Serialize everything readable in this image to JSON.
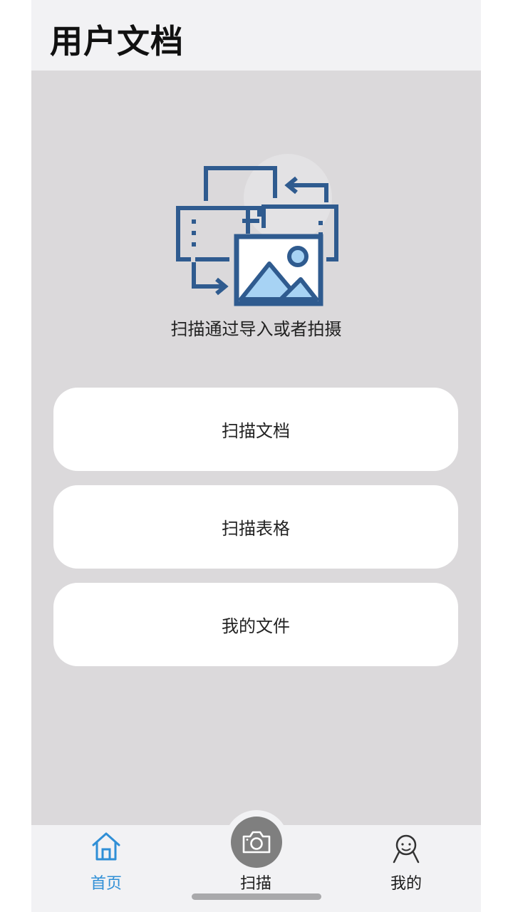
{
  "header": {
    "title": "用户文档"
  },
  "hero": {
    "caption": "扫描通过导入或者拍摄",
    "icon": "scan-document-illustration-icon"
  },
  "actions": [
    {
      "label": "扫描文档"
    },
    {
      "label": "扫描表格"
    },
    {
      "label": "我的文件"
    }
  ],
  "tabbar": {
    "home_label": "首页",
    "scan_label": "扫描",
    "mine_label": "我的",
    "active": "home",
    "active_color": "#2f8fd6"
  },
  "colors": {
    "background": "#dbd9db",
    "header_bg": "#f2f2f4",
    "button_bg": "#ffffff",
    "scan_button": "#7f7f7f",
    "illustration_blue": "#2f5b8f",
    "illustration_light_blue": "#a7d3f4"
  }
}
